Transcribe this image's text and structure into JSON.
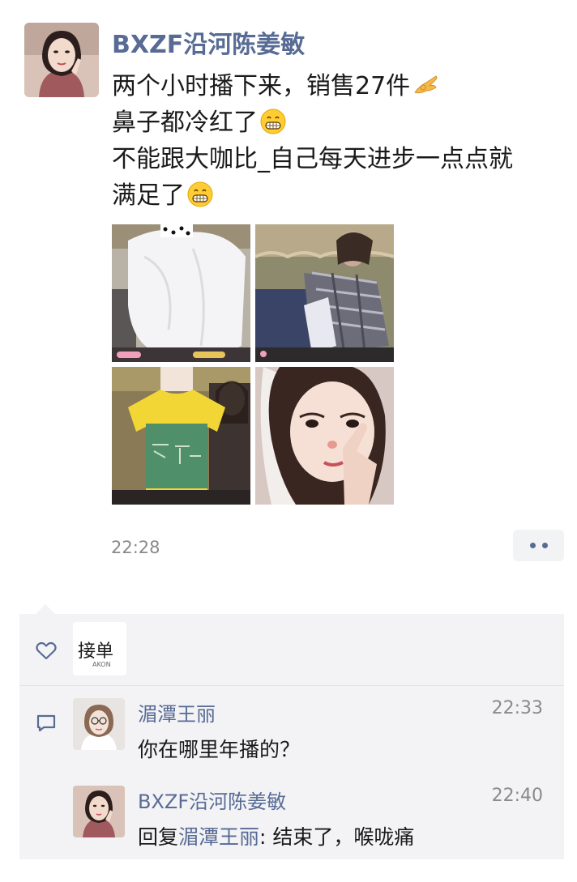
{
  "post": {
    "author": "BXZF沿河陈姜敏",
    "lines": [
      "两个小时播下来，销售27件",
      "鼻子都冷红了",
      "不能跟大咖比_自己每天进步一点点就",
      "满足了"
    ],
    "emojis": [
      "ok-hand-emoji",
      "grin-emoji",
      "grin-emoji"
    ],
    "photos": [
      "white-sheer-fabric-photo",
      "livestream-plaid-shirt-photo",
      "yellow-tshirt-mannequin-photo",
      "selfie-red-nose-photo"
    ],
    "timestamp": "22:28"
  },
  "interactions": {
    "likes": [
      {
        "avatar_text": "接单",
        "avatar_mark": "AKON"
      }
    ],
    "comments": [
      {
        "name": "湄潭王丽",
        "time": "22:33",
        "text": "你在哪里年播的？"
      },
      {
        "name": "BXZF沿河陈姜敏",
        "time": "22:40",
        "reply_prefix": "回复",
        "reply_to": "湄潭王丽",
        "text": ": 结束了，喉咙痛"
      }
    ]
  },
  "colors": {
    "link": "#576b95",
    "panel": "#f3f3f5",
    "timestamp": "#8a8a8a"
  }
}
